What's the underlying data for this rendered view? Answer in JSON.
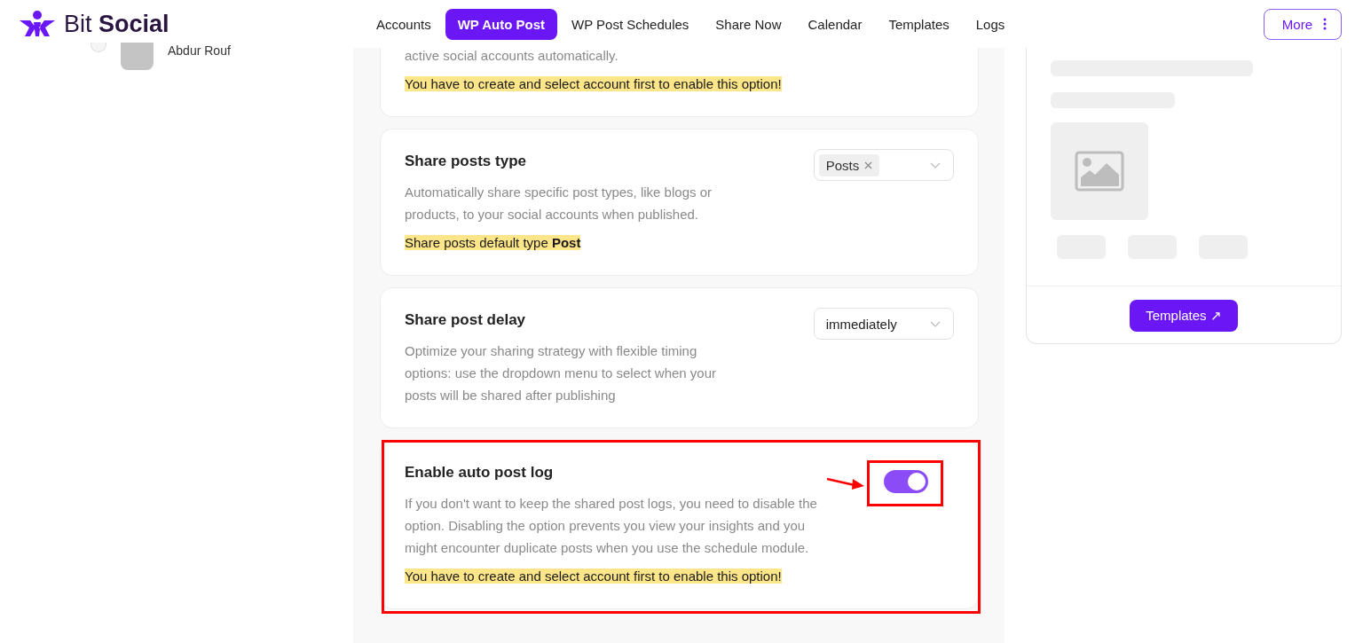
{
  "brand": {
    "name_light": "Bit",
    "name_bold": "Social"
  },
  "nav": [
    {
      "label": "Accounts",
      "selected": false
    },
    {
      "label": "WP Auto Post",
      "selected": true
    },
    {
      "label": "WP Post Schedules",
      "selected": false
    },
    {
      "label": "Share Now",
      "selected": false
    },
    {
      "label": "Calendar",
      "selected": false
    },
    {
      "label": "Templates",
      "selected": false
    },
    {
      "label": "Logs",
      "selected": false
    }
  ],
  "more_button": "More",
  "sidebar": {
    "account_name": "Abdur Rouf",
    "selected": false
  },
  "settings": [
    {
      "kind": "info",
      "description": "active social accounts automatically.",
      "notice": "You have to create and select account first to enable this option!"
    },
    {
      "kind": "multiselect",
      "title": "Share posts type",
      "description": "Automatically share specific post types, like blogs or products, to your social accounts when published.",
      "tags": [
        "Posts"
      ],
      "notice": "Share posts default type **Post**"
    },
    {
      "kind": "select",
      "title": "Share post delay",
      "description": "Optimize your sharing strategy with flexible timing options: use the dropdown menu to select when your posts will be shared after publishing",
      "value": "immediately"
    },
    {
      "kind": "toggle",
      "title": "Enable auto post log",
      "description": "If you don't want to keep the shared post logs, you need to disable the option. Disabling the option prevents you view your insights and you might encounter duplicate posts when you use the schedule module.",
      "on": true,
      "highlighted": true,
      "notice": "You have to create and select account first to enable this option!"
    }
  ],
  "preview_card": {
    "button": "Templates ↗"
  }
}
